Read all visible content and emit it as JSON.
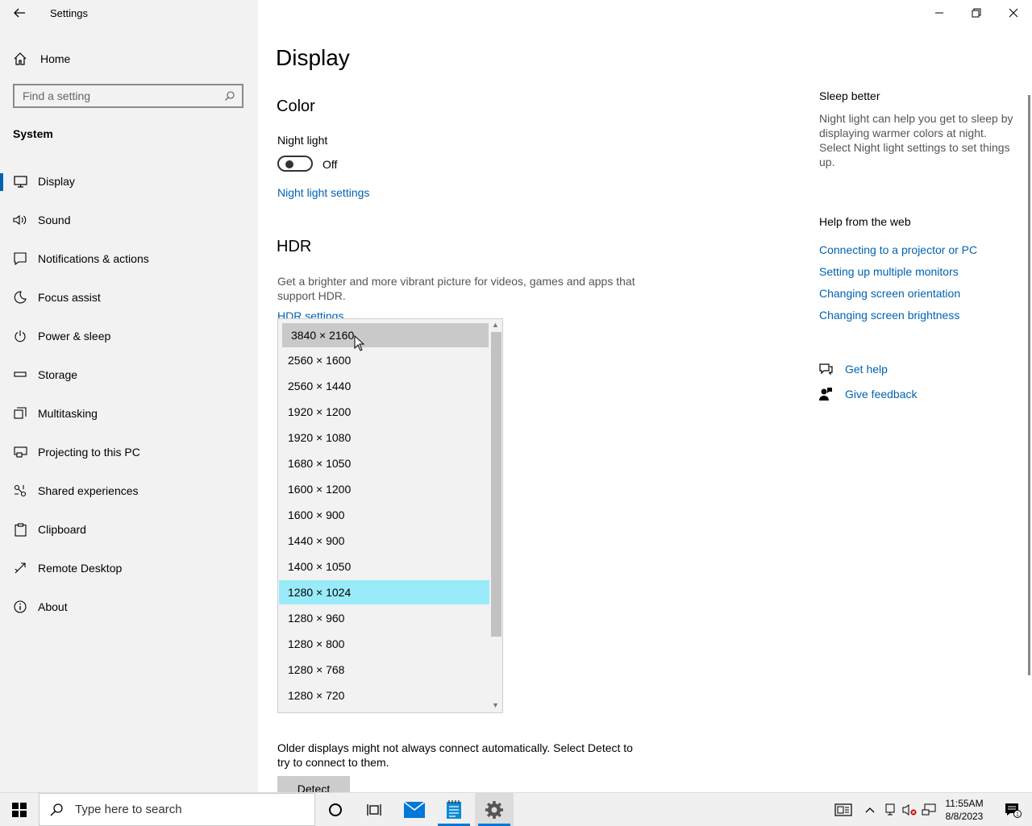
{
  "window": {
    "title": "Settings"
  },
  "sidebar": {
    "home_label": "Home",
    "search_placeholder": "Find a setting",
    "section_title": "System",
    "items": [
      {
        "label": "Display",
        "icon": "monitor-icon",
        "active": true
      },
      {
        "label": "Sound",
        "icon": "speaker-icon"
      },
      {
        "label": "Notifications & actions",
        "icon": "notification-icon"
      },
      {
        "label": "Focus assist",
        "icon": "moon-icon"
      },
      {
        "label": "Power & sleep",
        "icon": "power-icon"
      },
      {
        "label": "Storage",
        "icon": "storage-icon"
      },
      {
        "label": "Multitasking",
        "icon": "multitasking-icon"
      },
      {
        "label": "Projecting to this PC",
        "icon": "projector-icon"
      },
      {
        "label": "Shared experiences",
        "icon": "shared-icon"
      },
      {
        "label": "Clipboard",
        "icon": "clipboard-icon"
      },
      {
        "label": "Remote Desktop",
        "icon": "remote-desktop-icon"
      },
      {
        "label": "About",
        "icon": "info-icon"
      }
    ]
  },
  "main": {
    "title": "Display",
    "color_heading": "Color",
    "night_light_label": "Night light",
    "night_light_state": "Off",
    "night_light_link": "Night light settings",
    "hdr_heading": "HDR",
    "hdr_description": "Get a brighter and more vibrant picture for videos, games and apps that support HDR.",
    "hdr_link": "HDR settings",
    "older_displays_text": "Older displays might not always connect automatically. Select Detect to try to connect to them.",
    "detect_button": "Detect"
  },
  "resolution_dropdown": {
    "options": [
      "3840 × 2160",
      "2560 × 1600",
      "2560 × 1440",
      "1920 × 1200",
      "1920 × 1080",
      "1680 × 1050",
      "1600 × 1200",
      "1600 × 900",
      "1440 × 900",
      "1400 × 1050",
      "1280 × 1024",
      "1280 × 960",
      "1280 × 800",
      "1280 × 768",
      "1280 × 720"
    ],
    "hovered": "3840 × 2160",
    "selected": "1280 × 1024"
  },
  "right_panel": {
    "sleep_heading": "Sleep better",
    "sleep_text": "Night light can help you get to sleep by displaying warmer colors at night. Select Night light settings to set things up.",
    "help_heading": "Help from the web",
    "help_links": [
      "Connecting to a projector or PC",
      "Setting up multiple monitors",
      "Changing screen orientation",
      "Changing screen brightness"
    ],
    "get_help": "Get help",
    "give_feedback": "Give feedback"
  },
  "taskbar": {
    "search_placeholder": "Type here to search",
    "time": "11:55AM",
    "date": "8/8/2023"
  },
  "colors": {
    "accent": "#0063b1",
    "selected_option": "#99ebf9",
    "sidebar_bg": "#f2f2f2"
  }
}
